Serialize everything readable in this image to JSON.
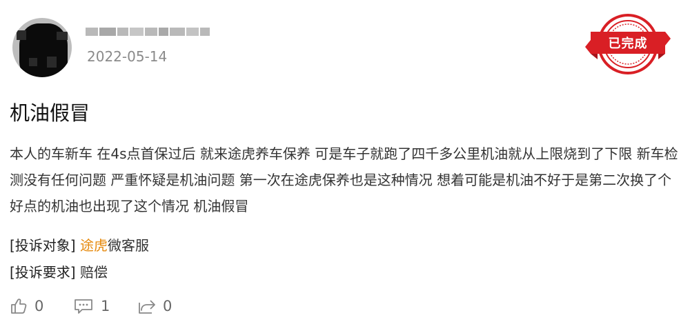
{
  "header": {
    "date": "2022-05-14",
    "stamp": "已完成"
  },
  "post": {
    "title": "机油假冒",
    "content": "本人的车新车 在4s点首保过后 就来途虎养车保养 可是车子就跑了四千多公里机油就从上限烧到了下限 新车检测没有任何问题 严重怀疑是机油问题 第一次在途虎保养也是这种情况 想着可能是机油不好于是第二次换了个好点的机油也出现了这个情况 机油假冒"
  },
  "complaint": {
    "target_label": "[投诉对象]",
    "target_highlight": "途虎",
    "target_rest": "微客服",
    "request_label": "[投诉要求]",
    "request_value": "赔偿"
  },
  "actions": {
    "likes": "0",
    "comments": "1",
    "shares": "0"
  }
}
